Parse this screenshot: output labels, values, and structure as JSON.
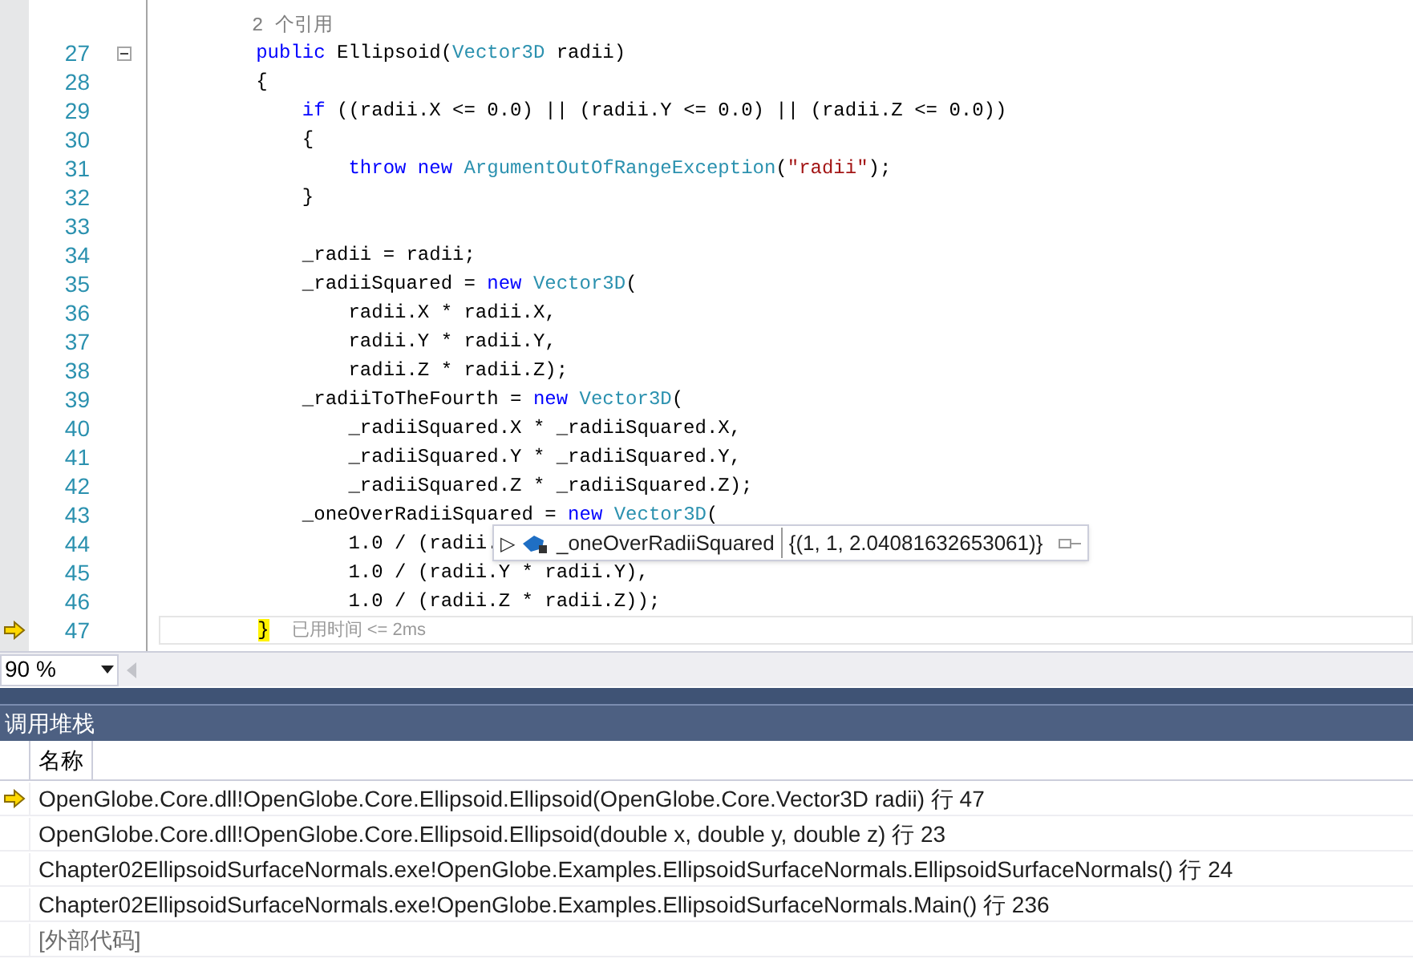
{
  "editor": {
    "lines": [
      {
        "kind": "codelens",
        "text": "2 个引用"
      },
      {
        "kind": "code",
        "number": "27",
        "current": false,
        "fold_marker": true,
        "tokens": [
          {
            "kind": "keyword",
            "text": "        public"
          },
          {
            "kind": "plain",
            "text": " Ellipsoid("
          },
          {
            "kind": "type",
            "text": "Vector3D"
          },
          {
            "kind": "plain",
            "text": " radii)"
          }
        ]
      },
      {
        "kind": "code",
        "number": "28",
        "current": false,
        "fold_marker": false,
        "tokens": [
          {
            "kind": "plain",
            "text": "        {"
          }
        ]
      },
      {
        "kind": "code",
        "number": "29",
        "current": false,
        "fold_marker": false,
        "tokens": [
          {
            "kind": "keyword",
            "text": "            if"
          },
          {
            "kind": "plain",
            "text": " ((radii.X <= 0.0) || (radii.Y <= 0.0) || (radii.Z <= 0.0))"
          }
        ]
      },
      {
        "kind": "code",
        "number": "30",
        "current": false,
        "fold_marker": false,
        "tokens": [
          {
            "kind": "plain",
            "text": "            {"
          }
        ]
      },
      {
        "kind": "code",
        "number": "31",
        "current": false,
        "fold_marker": false,
        "tokens": [
          {
            "kind": "keyword",
            "text": "                throw new "
          },
          {
            "kind": "type",
            "text": "ArgumentOutOfRangeException"
          },
          {
            "kind": "plain",
            "text": "("
          },
          {
            "kind": "string",
            "text": "\"radii\""
          },
          {
            "kind": "plain",
            "text": ");"
          }
        ]
      },
      {
        "kind": "code",
        "number": "32",
        "current": false,
        "fold_marker": false,
        "tokens": [
          {
            "kind": "plain",
            "text": "            }"
          }
        ]
      },
      {
        "kind": "code",
        "number": "33",
        "current": false,
        "fold_marker": false
      },
      {
        "kind": "code",
        "number": "34",
        "current": false,
        "fold_marker": false,
        "tokens": [
          {
            "kind": "plain",
            "text": "            _radii = radii;"
          }
        ]
      },
      {
        "kind": "code",
        "number": "35",
        "current": false,
        "fold_marker": false,
        "tokens": [
          {
            "kind": "plain",
            "text": "            _radiiSquared = "
          },
          {
            "kind": "keyword",
            "text": "new "
          },
          {
            "kind": "type",
            "text": "Vector3D"
          },
          {
            "kind": "plain",
            "text": "("
          }
        ]
      },
      {
        "kind": "code",
        "number": "36",
        "current": false,
        "fold_marker": false,
        "tokens": [
          {
            "kind": "plain",
            "text": "                radii.X * radii.X,"
          }
        ]
      },
      {
        "kind": "code",
        "number": "37",
        "current": false,
        "fold_marker": false,
        "tokens": [
          {
            "kind": "plain",
            "text": "                radii.Y * radii.Y,"
          }
        ]
      },
      {
        "kind": "code",
        "number": "38",
        "current": false,
        "fold_marker": false,
        "tokens": [
          {
            "kind": "plain",
            "text": "                radii.Z * radii.Z);"
          }
        ]
      },
      {
        "kind": "code",
        "number": "39",
        "current": false,
        "fold_marker": false,
        "tokens": [
          {
            "kind": "plain",
            "text": "            _radiiToTheFourth = "
          },
          {
            "kind": "keyword",
            "text": "new "
          },
          {
            "kind": "type",
            "text": "Vector3D"
          },
          {
            "kind": "plain",
            "text": "("
          }
        ]
      },
      {
        "kind": "code",
        "number": "40",
        "current": false,
        "fold_marker": false,
        "tokens": [
          {
            "kind": "plain",
            "text": "                _radiiSquared.X * _radiiSquared.X,"
          }
        ]
      },
      {
        "kind": "code",
        "number": "41",
        "current": false,
        "fold_marker": false,
        "tokens": [
          {
            "kind": "plain",
            "text": "                _radiiSquared.Y * _radiiSquared.Y,"
          }
        ]
      },
      {
        "kind": "code",
        "number": "42",
        "current": false,
        "fold_marker": false,
        "tokens": [
          {
            "kind": "plain",
            "text": "                _radiiSquared.Z * _radiiSquared.Z);"
          }
        ]
      },
      {
        "kind": "code",
        "number": "43",
        "current": false,
        "fold_marker": false,
        "tokens": [
          {
            "kind": "plain",
            "text": "            _oneOverRadiiSquared = "
          },
          {
            "kind": "keyword",
            "text": "new "
          },
          {
            "kind": "type",
            "text": "Vector3D"
          },
          {
            "kind": "plain",
            "text": "("
          }
        ]
      },
      {
        "kind": "code",
        "number": "44",
        "current": false,
        "fold_marker": false,
        "tokens": [
          {
            "kind": "plain",
            "text": "                1.0 / (radii."
          }
        ]
      },
      {
        "kind": "code",
        "number": "45",
        "current": false,
        "fold_marker": false,
        "tokens": [
          {
            "kind": "plain",
            "text": "                1.0 / (radii.Y * radii.Y),"
          }
        ]
      },
      {
        "kind": "code",
        "number": "46",
        "current": false,
        "fold_marker": false,
        "tokens": [
          {
            "kind": "plain",
            "text": "                1.0 / (radii.Z * radii.Z));"
          }
        ]
      },
      {
        "kind": "code",
        "number": "47",
        "current": true,
        "fold_marker": false,
        "tokens": [
          {
            "kind": "brace",
            "text": "        }"
          }
        ],
        "annotation": "已用时间 <= 2ms"
      }
    ],
    "datatip": {
      "name": "_oneOverRadiiSquared",
      "value": "{(1, 1, 2.04081632653061)}",
      "expand": "▷"
    },
    "zoom": {
      "value": "90 %"
    }
  },
  "call_stack": {
    "title": "调用堆栈",
    "columns": [
      "名称"
    ],
    "rows": [
      {
        "text": "OpenGlobe.Core.dll!OpenGlobe.Core.Ellipsoid.Ellipsoid(OpenGlobe.Core.Vector3D radii) 行 47",
        "current": true,
        "external": false
      },
      {
        "text": "OpenGlobe.Core.dll!OpenGlobe.Core.Ellipsoid.Ellipsoid(double x, double y, double z) 行 23",
        "current": false,
        "external": false
      },
      {
        "text": "Chapter02EllipsoidSurfaceNormals.exe!OpenGlobe.Examples.EllipsoidSurfaceNormals.EllipsoidSurfaceNormals() 行 24",
        "current": false,
        "external": false
      },
      {
        "text": "Chapter02EllipsoidSurfaceNormals.exe!OpenGlobe.Examples.EllipsoidSurfaceNormals.Main() 行 236",
        "current": false,
        "external": false
      },
      {
        "text": "[外部代码]",
        "current": false,
        "external": true
      }
    ]
  }
}
